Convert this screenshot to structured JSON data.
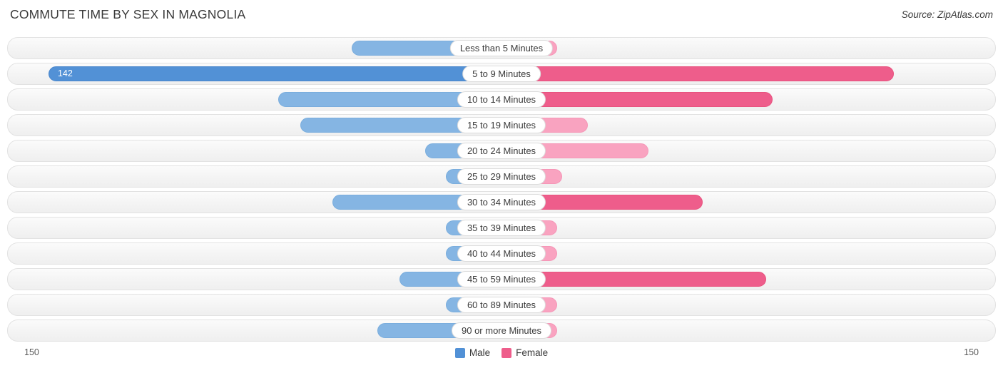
{
  "title": "COMMUTE TIME BY SEX IN MAGNOLIA",
  "source": "Source: ZipAtlas.com",
  "axis": {
    "left": "150",
    "right": "150"
  },
  "legend": [
    {
      "label": "Male",
      "color": "#5291d6"
    },
    {
      "label": "Female",
      "color": "#ee5d8b"
    }
  ],
  "colors": {
    "male_light": "#85b5e3",
    "male_dark": "#5291d6",
    "female_light": "#f9a3c0",
    "female_dark": "#ee5d8b"
  },
  "chart_data": {
    "type": "bar",
    "orientation": "horizontal-diverging",
    "title": "COMMUTE TIME BY SEX IN MAGNOLIA",
    "xlabel": "",
    "ylabel": "",
    "xlim": [
      150,
      150
    ],
    "grid": false,
    "legend_position": "bottom-center",
    "categories": [
      "Less than 5 Minutes",
      "5 to 9 Minutes",
      "10 to 14 Minutes",
      "15 to 19 Minutes",
      "20 to 24 Minutes",
      "25 to 29 Minutes",
      "30 to 34 Minutes",
      "35 to 39 Minutes",
      "40 to 44 Minutes",
      "45 to 59 Minutes",
      "60 to 89 Minutes",
      "90 or more Minutes"
    ],
    "series": [
      {
        "name": "Male",
        "values": [
          47,
          142,
          70,
          63,
          24,
          4,
          53,
          0,
          9,
          32,
          0,
          39
        ]
      },
      {
        "name": "Female",
        "values": [
          6,
          123,
          85,
          27,
          46,
          19,
          63,
          0,
          0,
          83,
          0,
          0
        ]
      }
    ]
  }
}
